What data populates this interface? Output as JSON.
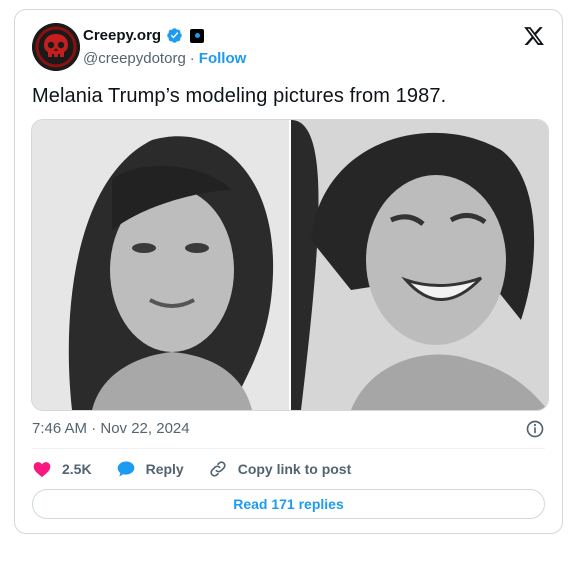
{
  "tweet": {
    "author": {
      "display_name": "Creepy.org",
      "handle": "@creepydotorg",
      "separator": "·",
      "follow_label": "Follow",
      "avatar_icon": "red-skull-icon",
      "verified_icon": "verified-badge-icon",
      "affiliate_icon": "affiliate-badge-icon"
    },
    "platform_icon": "x-logo-icon",
    "text": "Melania Trump’s modeling pictures from 1987.",
    "media": [
      {
        "name": "photo-left",
        "description_icon": "bw-portrait-photo"
      },
      {
        "name": "photo-right",
        "description_icon": "bw-portrait-photo"
      }
    ],
    "timestamp": "7:46 AM · Nov 22, 2024",
    "info_icon": "info-icon",
    "actions": {
      "like_count": "2.5K",
      "reply_label": "Reply",
      "copy_link_label": "Copy link to post"
    },
    "read_replies_label": "Read 171 replies"
  },
  "colors": {
    "accent": "#1d9bf0",
    "like": "#f91880",
    "muted_text": "#536471",
    "border": "#cfd9de"
  }
}
